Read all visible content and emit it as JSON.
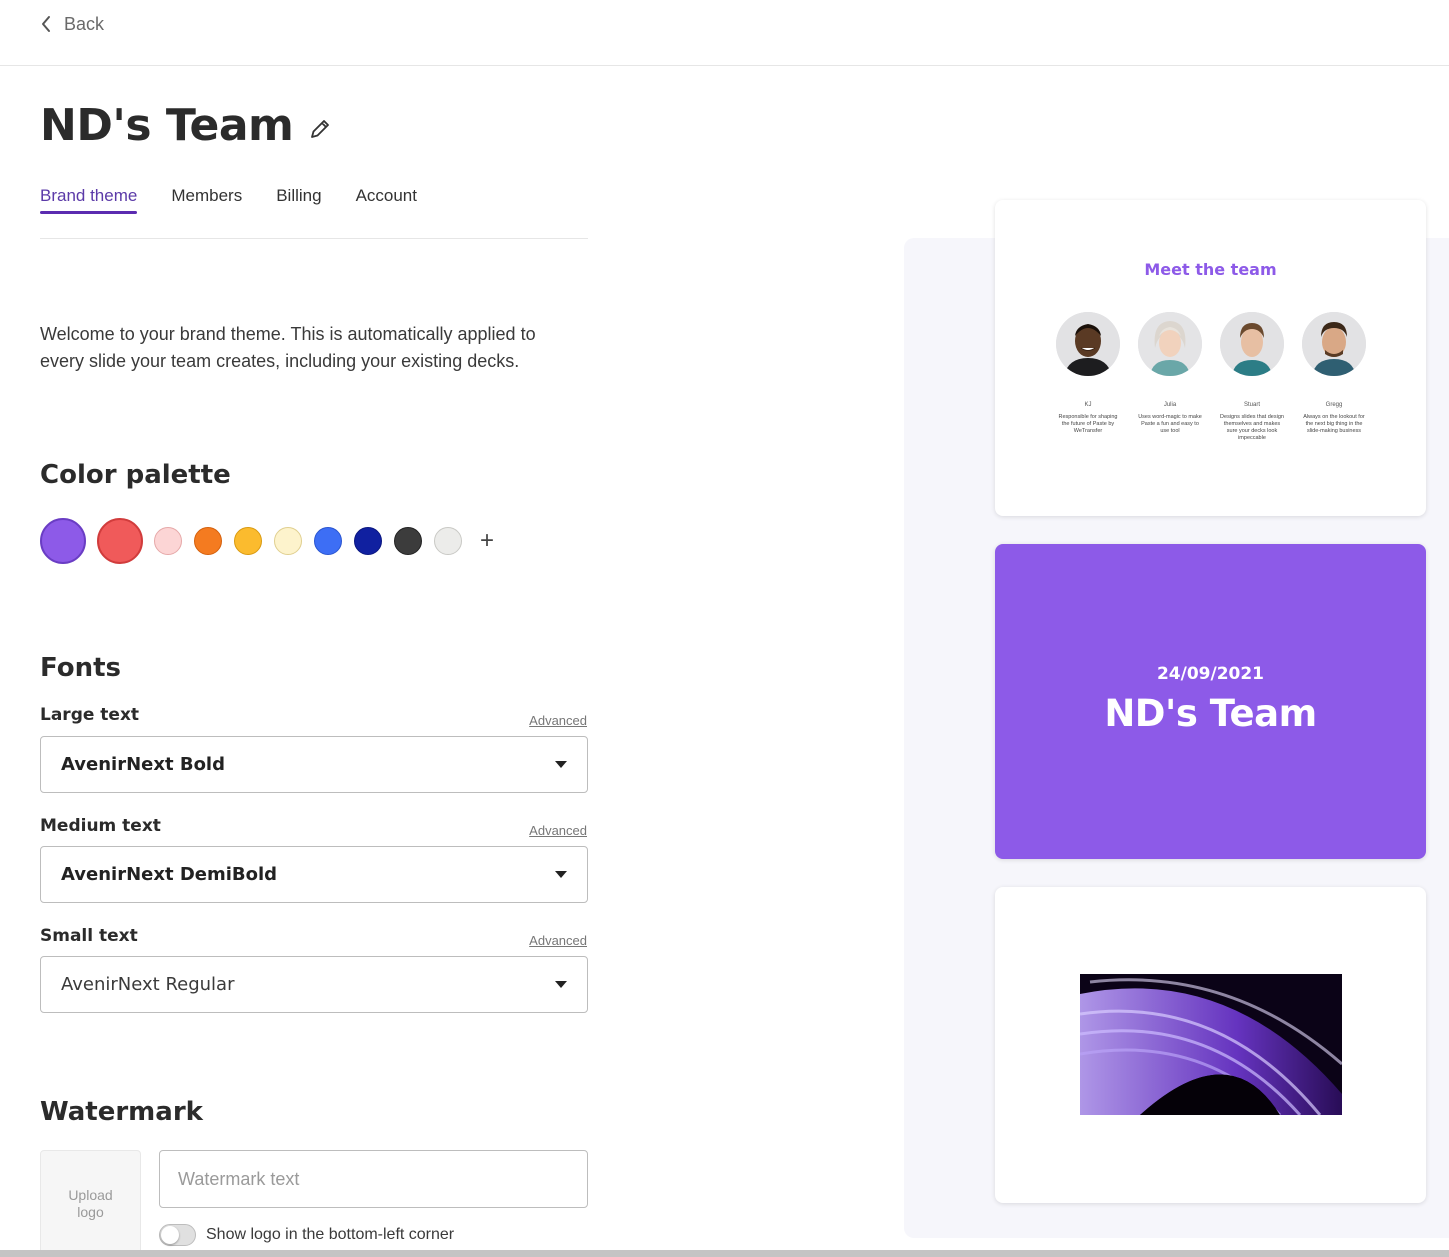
{
  "topbar": {
    "back_label": "Back",
    "back_icon": "chevron-left-icon"
  },
  "header": {
    "title": "ND's Team",
    "edit_icon": "pencil-icon"
  },
  "tabs": [
    {
      "label": "Brand theme",
      "active": true
    },
    {
      "label": "Members",
      "active": false
    },
    {
      "label": "Billing",
      "active": false
    },
    {
      "label": "Account",
      "active": false
    }
  ],
  "intro": "Welcome to your brand theme. This is automatically applied to every slide your team creates, including your existing decks.",
  "palette": {
    "title": "Color palette",
    "add_label": "+",
    "colors": [
      "#8d5ae8",
      "#f05a5a",
      "#fcd5d5",
      "#f47b20",
      "#fbbb2e",
      "#fdf3cc",
      "#3d6ef5",
      "#1020a0",
      "#3c3c3c",
      "#ececea"
    ]
  },
  "fonts": {
    "title": "Fonts",
    "large": {
      "label": "Large text",
      "advanced": "Advanced",
      "value": "AvenirNext Bold"
    },
    "medium": {
      "label": "Medium text",
      "advanced": "Advanced",
      "value": "AvenirNext DemiBold"
    },
    "small": {
      "label": "Small text",
      "advanced": "Advanced",
      "value": "AvenirNext Regular"
    }
  },
  "watermark": {
    "title": "Watermark",
    "upload_label": "Upload logo",
    "placeholder": "Watermark text",
    "value": "",
    "toggle_label": "Show logo in the bottom-left corner",
    "toggle_on": false
  },
  "preview": {
    "team_slide": {
      "title": "Meet the team",
      "members": [
        {
          "name": "KJ",
          "desc": "Responsible for shaping the future of Paste by WeTransfer"
        },
        {
          "name": "Julia",
          "desc": "Uses word-magic to make Paste a fun and easy to use tool"
        },
        {
          "name": "Stuart",
          "desc": "Designs slides that design themselves and makes sure your decks look impeccable"
        },
        {
          "name": "Gregg",
          "desc": "Always on the lookout for the next big thing in the slide-making business"
        }
      ]
    },
    "title_slide": {
      "date": "24/09/2021",
      "title": "ND's Team"
    },
    "accent": "#8d5ae8"
  }
}
